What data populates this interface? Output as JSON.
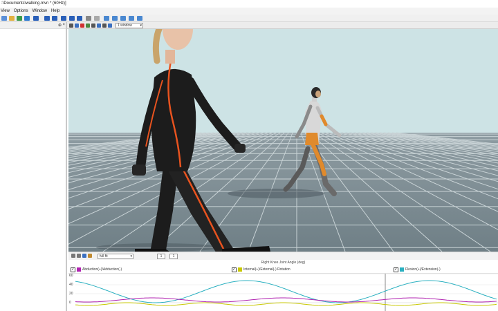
{
  "window": {
    "title": ":\\Documents\\walking.mvn * (60Hz)]"
  },
  "menu": [
    "View",
    "Options",
    "Window",
    "Help"
  ],
  "viewport": {
    "layout_select": "1 window"
  },
  "graph": {
    "zoom_select": "full fit",
    "spin_a": "1",
    "spin_b": "1",
    "title": "Right Knee Joint Angle (deg)",
    "yticks": [
      "60",
      "40",
      "20",
      "0"
    ],
    "legend": [
      {
        "label": "Abduction(+)/Adduction(-)",
        "color": "#b022b0",
        "checked": true
      },
      {
        "label": "Internal(+)/External(-) Rotation",
        "color": "#c8c800",
        "checked": true
      },
      {
        "label": "Flexion(+)/Extension(-)",
        "color": "#2ab0c0",
        "checked": true
      }
    ]
  },
  "colors": {
    "sky": "#cde3e5",
    "floor": "#7f8e95",
    "suit": "#1c1c1c",
    "stripe": "#e8531f",
    "avatar_orange": "#e08a2c"
  },
  "icons": [
    "new-icon",
    "open-icon",
    "play-icon",
    "pause-icon",
    "record-icon",
    "skip-start-icon",
    "skip-end-icon",
    "pin-icon",
    "close-icon"
  ]
}
